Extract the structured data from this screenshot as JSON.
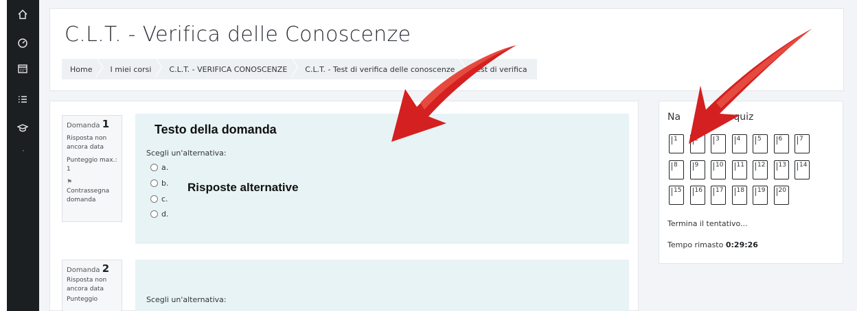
{
  "sidebar": {
    "icons": [
      "home-icon",
      "dashboard-icon",
      "calendar-icon",
      "list-icon",
      "graduation-cap-icon"
    ]
  },
  "header": {
    "title": "C.L.T. - Verifica delle Conoscenze",
    "breadcrumb": [
      "Home",
      "I miei corsi",
      "C.L.T. - VERIFICA CONOSCENZE",
      "C.L.T. - Test di verifica delle conoscenze",
      "Test di verifica"
    ]
  },
  "questions": [
    {
      "label": "Domanda",
      "number": "1",
      "status": "Risposta non ancora data",
      "score": "Punteggio max.: 1",
      "flag": "Contrassegna domanda",
      "text_annotation": "Testo della domanda",
      "prompt": "Scegli un'alternativa:",
      "options": [
        "a.",
        "b.",
        "c.",
        "d."
      ],
      "answers_annotation": "Risposte alternative"
    },
    {
      "label": "Domanda",
      "number": "2",
      "status": "Risposta non ancora data",
      "score": "Punteggio",
      "prompt": "Scegli un'alternativa:"
    }
  ],
  "quiz_nav": {
    "title": "Navigazione quiz",
    "title_visible": "Na        zione quiz",
    "buttons": [
      "1",
      "2",
      "3",
      "4",
      "5",
      "6",
      "7",
      "8",
      "9",
      "10",
      "11",
      "12",
      "13",
      "14",
      "15",
      "16",
      "17",
      "18",
      "19",
      "20"
    ],
    "finish_label": "Termina il tentativo...",
    "time_label": "Tempo rimasto",
    "time_value": "0:29:26"
  },
  "colors": {
    "sidebar": "#1c1f22",
    "page_bg": "#f2f4f7",
    "question_bg": "#e7f3f5",
    "arrow": "#d42020"
  }
}
